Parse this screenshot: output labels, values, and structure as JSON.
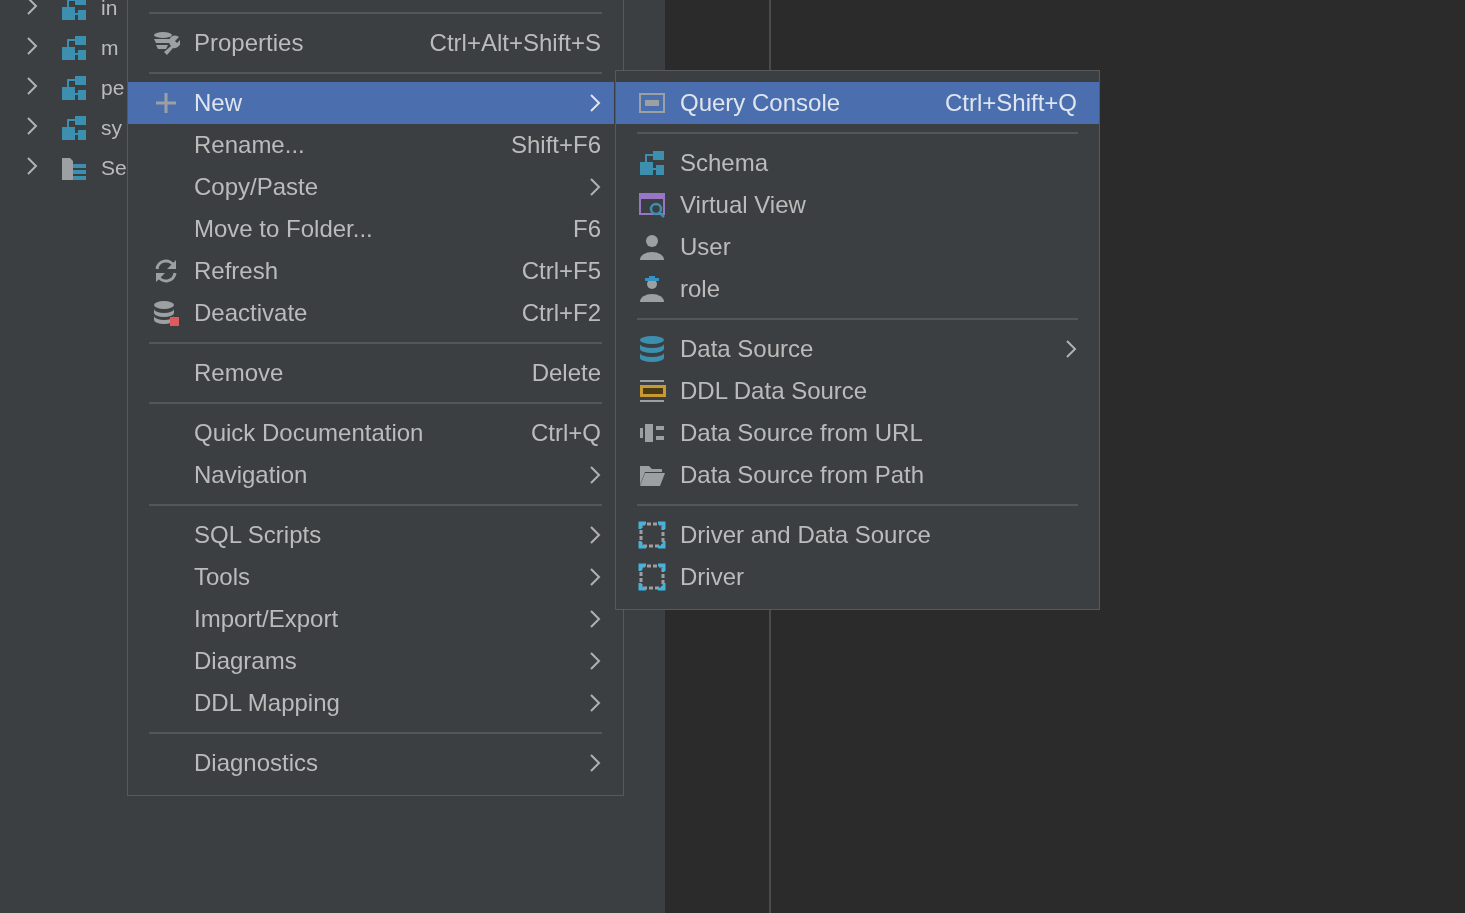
{
  "tree": [
    {
      "label": "in",
      "expanded": false
    },
    {
      "label": "m",
      "expanded": false
    },
    {
      "label": "pe",
      "expanded": false
    },
    {
      "label": "sy",
      "expanded": false
    },
    {
      "label": "Se",
      "expanded": false
    }
  ],
  "context_menu": [
    {
      "kind": "separator"
    },
    {
      "kind": "item",
      "label": "Properties",
      "shortcut": "Ctrl+Alt+Shift+S",
      "submenu": false,
      "selected": false
    },
    {
      "kind": "separator"
    },
    {
      "kind": "item",
      "label": "New",
      "submenu": true,
      "selected": true
    },
    {
      "kind": "item",
      "label": "Rename...",
      "shortcut": "Shift+F6",
      "submenu": false,
      "selected": false
    },
    {
      "kind": "item",
      "label": "Copy/Paste",
      "submenu": true,
      "selected": false
    },
    {
      "kind": "item",
      "label": "Move to Folder...",
      "shortcut": "F6",
      "submenu": false,
      "selected": false
    },
    {
      "kind": "item",
      "label": "Refresh",
      "shortcut": "Ctrl+F5",
      "submenu": false,
      "selected": false
    },
    {
      "kind": "item",
      "label": "Deactivate",
      "shortcut": "Ctrl+F2",
      "submenu": false,
      "selected": false
    },
    {
      "kind": "separator"
    },
    {
      "kind": "item",
      "label": "Remove",
      "shortcut": "Delete",
      "submenu": false,
      "selected": false
    },
    {
      "kind": "separator"
    },
    {
      "kind": "item",
      "label": "Quick Documentation",
      "shortcut": "Ctrl+Q",
      "submenu": false,
      "selected": false
    },
    {
      "kind": "item",
      "label": "Navigation",
      "submenu": true,
      "selected": false
    },
    {
      "kind": "separator"
    },
    {
      "kind": "item",
      "label": "SQL Scripts",
      "submenu": true,
      "selected": false
    },
    {
      "kind": "item",
      "label": "Tools",
      "submenu": true,
      "selected": false
    },
    {
      "kind": "item",
      "label": "Import/Export",
      "submenu": true,
      "selected": false
    },
    {
      "kind": "item",
      "label": "Diagrams",
      "submenu": true,
      "selected": false
    },
    {
      "kind": "item",
      "label": "DDL Mapping",
      "submenu": true,
      "selected": false
    },
    {
      "kind": "separator"
    },
    {
      "kind": "item",
      "label": "Diagnostics",
      "submenu": true,
      "selected": false
    }
  ],
  "new_submenu": [
    {
      "kind": "item",
      "label": "Query Console",
      "shortcut": "Ctrl+Shift+Q",
      "submenu": false,
      "selected": true
    },
    {
      "kind": "separator"
    },
    {
      "kind": "item",
      "label": "Schema",
      "submenu": false,
      "selected": false
    },
    {
      "kind": "item",
      "label": "Virtual View",
      "submenu": false,
      "selected": false
    },
    {
      "kind": "item",
      "label": "User",
      "submenu": false,
      "selected": false
    },
    {
      "kind": "item",
      "label": "role",
      "submenu": false,
      "selected": false
    },
    {
      "kind": "separator"
    },
    {
      "kind": "item",
      "label": "Data Source",
      "submenu": true,
      "selected": false
    },
    {
      "kind": "item",
      "label": "DDL Data Source",
      "submenu": false,
      "selected": false
    },
    {
      "kind": "item",
      "label": "Data Source from URL",
      "submenu": false,
      "selected": false
    },
    {
      "kind": "item",
      "label": "Data Source from Path",
      "submenu": false,
      "selected": false
    },
    {
      "kind": "separator"
    },
    {
      "kind": "item",
      "label": "Driver and Data Source",
      "submenu": false,
      "selected": false
    },
    {
      "kind": "item",
      "label": "Driver",
      "submenu": false,
      "selected": false
    }
  ]
}
